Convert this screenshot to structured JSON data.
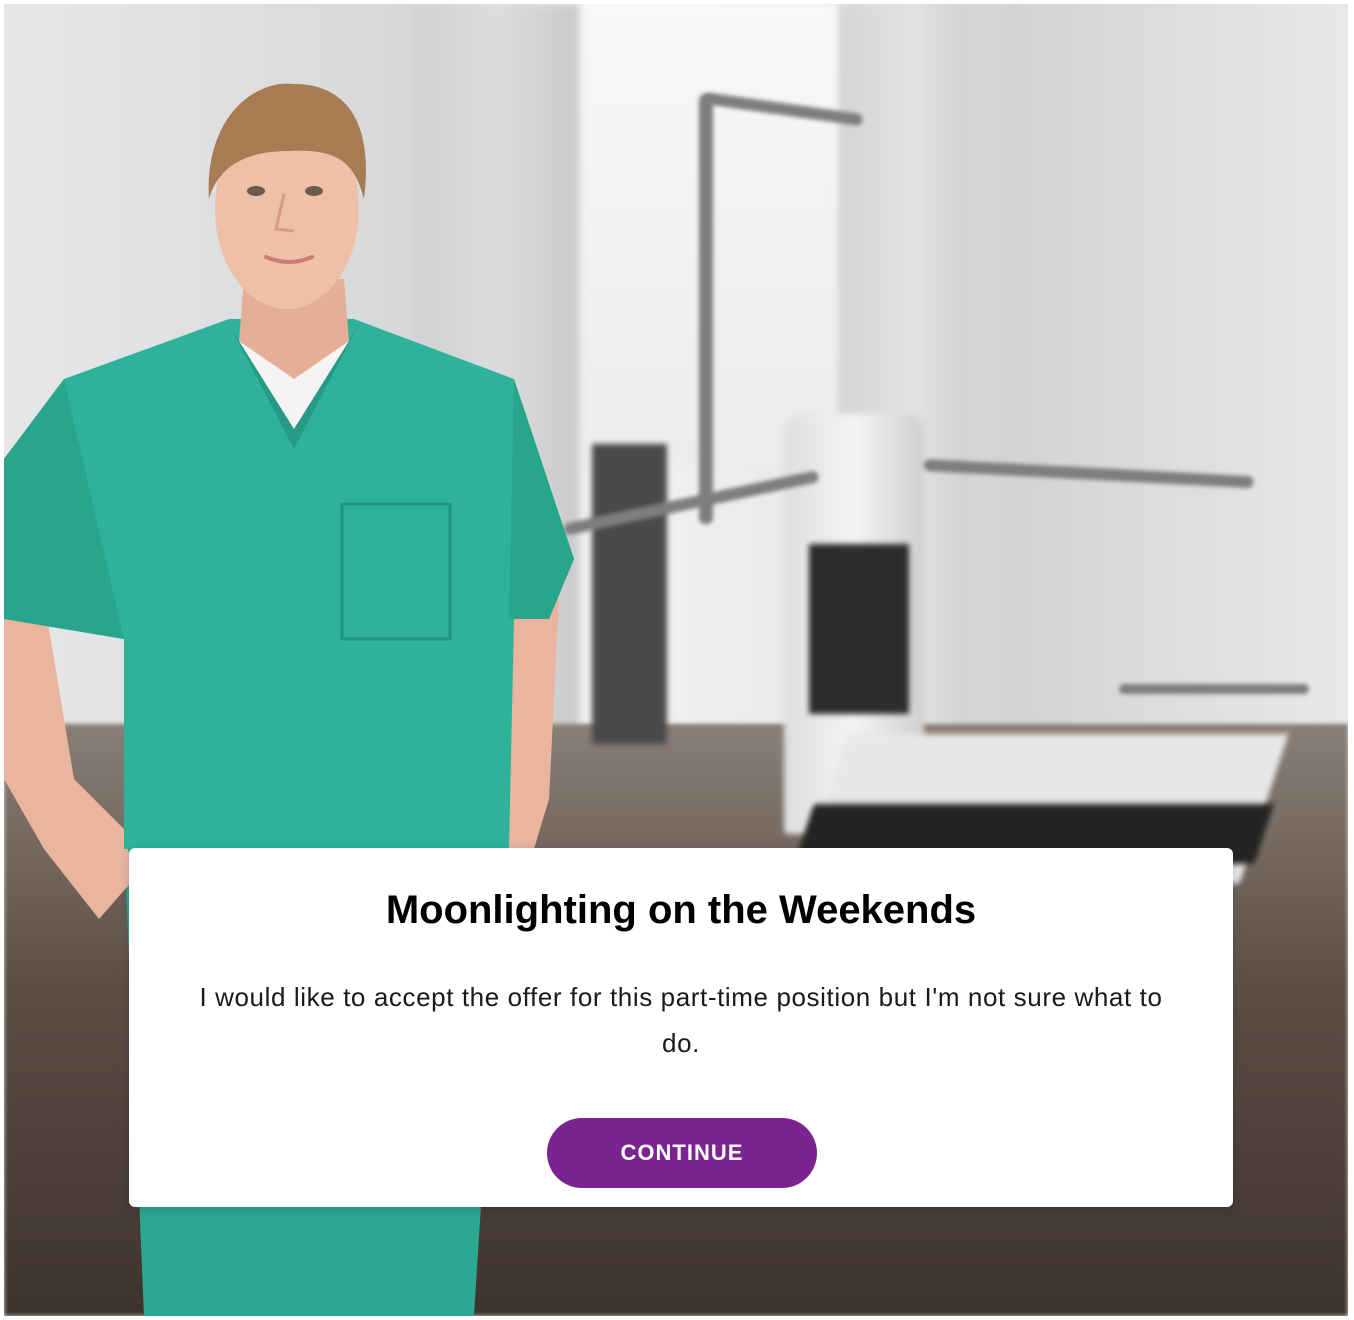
{
  "dialog": {
    "title": "Moonlighting on the Weekends",
    "body": "I would like to accept the offer for this part-time position but I'm not sure what to do.",
    "continue_label": "CONTINUE"
  },
  "colors": {
    "accent": "#7b2390",
    "scrubs": "#2fb29a",
    "card_background": "#ffffff"
  }
}
